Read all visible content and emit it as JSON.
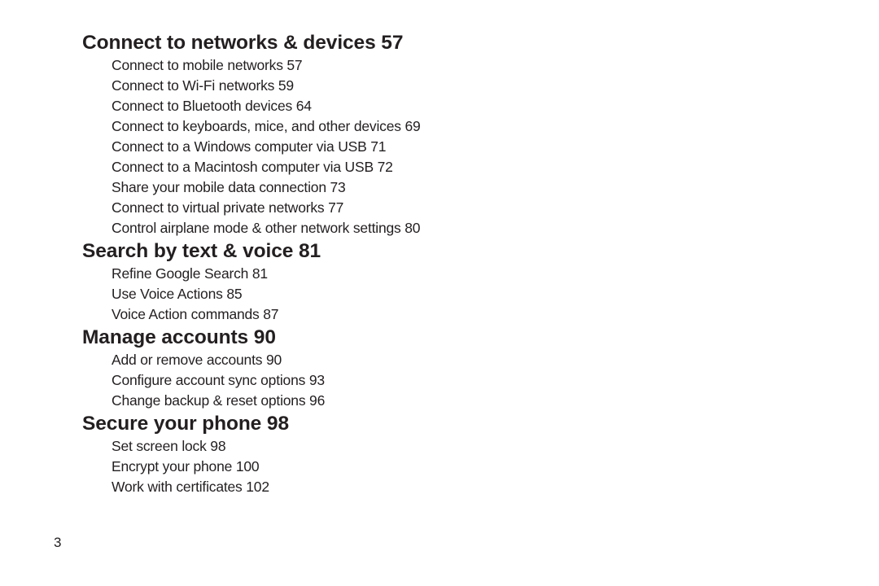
{
  "sections": [
    {
      "title": "Connect to networks & devices 57",
      "items": [
        "Connect to mobile networks 57",
        "Connect to Wi-Fi networks 59",
        "Connect to Bluetooth devices 64",
        "Connect to keyboards, mice, and other devices 69",
        "Connect to a Windows computer via USB 71",
        "Connect to a Macintosh computer via USB 72",
        "Share your mobile data connection 73",
        "Connect to virtual private networks 77",
        "Control airplane mode & other network settings 80"
      ]
    },
    {
      "title": "Search by text & voice 81",
      "items": [
        "Refine Google Search 81",
        "Use Voice Actions 85",
        "Voice Action commands 87"
      ]
    },
    {
      "title": "Manage accounts 90",
      "items": [
        "Add or remove accounts 90",
        "Configure account sync options 93",
        "Change backup & reset options 96"
      ]
    },
    {
      "title": "Secure your phone 98",
      "items": [
        "Set screen lock 98",
        "Encrypt your phone 100",
        "Work with certificates 102"
      ]
    }
  ],
  "page_number": "3"
}
